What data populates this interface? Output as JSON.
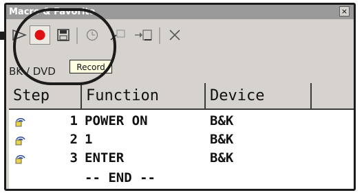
{
  "window": {
    "title": "Macro & Favorite",
    "close_label": "×"
  },
  "toolbar": {
    "tooltip": "Record",
    "icons": [
      "play-icon",
      "record-icon",
      "save-icon",
      "clock-icon",
      "insert-icon",
      "macro-icon",
      "delete-icon"
    ]
  },
  "path": {
    "text": "BK / DVD"
  },
  "grid": {
    "headers": [
      "Step",
      "Function",
      "Device"
    ],
    "rows": [
      {
        "step": "1",
        "function": "POWER ON",
        "device": "B&K"
      },
      {
        "step": "2",
        "function": "1",
        "device": "B&K"
      },
      {
        "step": "3",
        "function": "ENTER",
        "device": "B&K"
      }
    ],
    "end_marker": "-- END --"
  },
  "colors": {
    "record_red": "#e01010",
    "titlebar": "#9a9a9a",
    "tooltip_bg": "#ffffe1"
  }
}
